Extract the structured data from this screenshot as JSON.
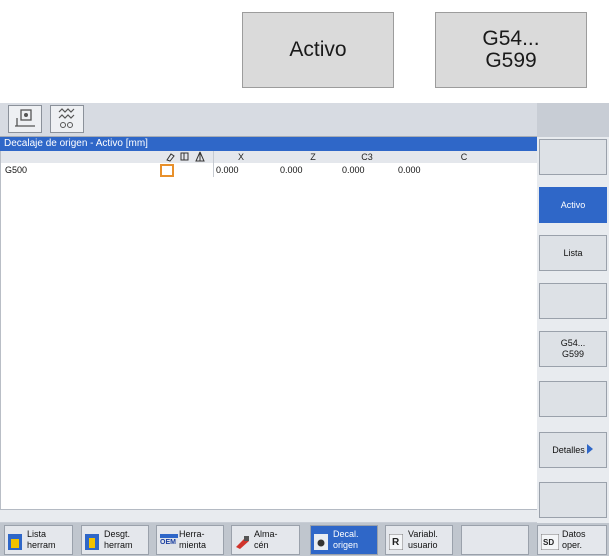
{
  "keys": {
    "active": "Activo",
    "g54_line1": "G54...",
    "g54_line2": "G599"
  },
  "header": {
    "title": "Decalaje de origen - Activo [mm]"
  },
  "table": {
    "columns": [
      "X",
      "Z",
      "C3",
      "C"
    ],
    "rows": [
      {
        "name": "G500",
        "values": [
          "0.000",
          "0.000",
          "0.000",
          "0.000"
        ]
      }
    ]
  },
  "softkeys": {
    "activo": "Activo",
    "lista": "Lista",
    "g54_1": "G54...",
    "g54_2": "G599",
    "detalles": "Detalles"
  },
  "hbar": {
    "lista_1": "Lista",
    "lista_2": "herram",
    "desgt_1": "Desgt.",
    "desgt_2": "herram",
    "herra_1": "Herra-",
    "herra_2": "mienta",
    "alma_1": "Alma-",
    "alma_2": "cén",
    "decal_1": "Decal.",
    "decal_2": "origen",
    "variab_1": "Variabl.",
    "variab_2": "usuario",
    "datos_1": "Datos",
    "datos_2": "oper."
  },
  "icon_text": {
    "oem": "OEM",
    "r": "R",
    "sd": "SD"
  },
  "colors": {
    "accent": "#2f67c8",
    "checkbox": "#e8902b",
    "screen_bg": "#c8cdd5"
  }
}
